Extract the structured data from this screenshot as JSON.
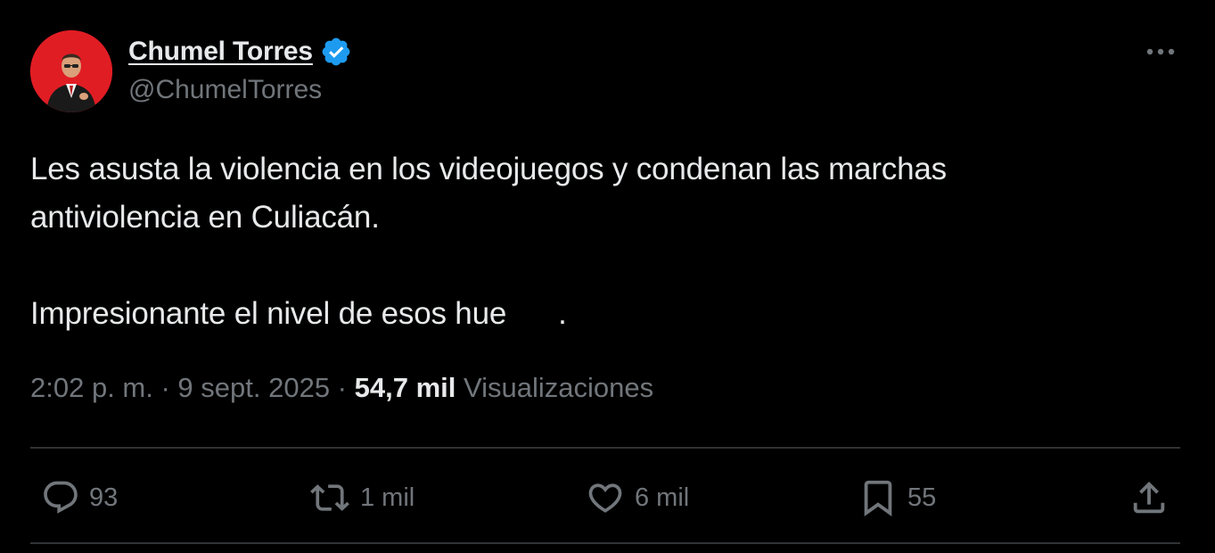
{
  "author": {
    "display_name": "Chumel Torres",
    "handle": "@ChumelTorres",
    "verified": true,
    "avatar_bg": "#e11d24"
  },
  "tweet": {
    "line1": "Les asusta la violencia en los videojuegos y condenan las marchas",
    "line2": "antiviolencia en Culiacán.",
    "line3": "Impresionante el nivel de esos hue",
    "line3_end": "."
  },
  "meta": {
    "time": "2:02 p. m.",
    "sep1": " · ",
    "date": "9 sept. 2025",
    "sep2": " · ",
    "views_count": "54,7 mil",
    "views_label": "Visualizaciones"
  },
  "actions": {
    "replies": "93",
    "reposts": "1 mil",
    "likes": "6 mil",
    "bookmarks": "55"
  },
  "colors": {
    "background": "#000000",
    "text": "#e7e9ea",
    "muted": "#71767b",
    "divider": "#2f3336",
    "verified_blue": "#1d9bf0"
  },
  "icons": {
    "more": "more-horizontal-icon",
    "reply": "reply-icon",
    "repost": "repost-icon",
    "like": "heart-icon",
    "bookmark": "bookmark-icon",
    "share": "share-icon",
    "verified": "verified-badge-icon"
  }
}
